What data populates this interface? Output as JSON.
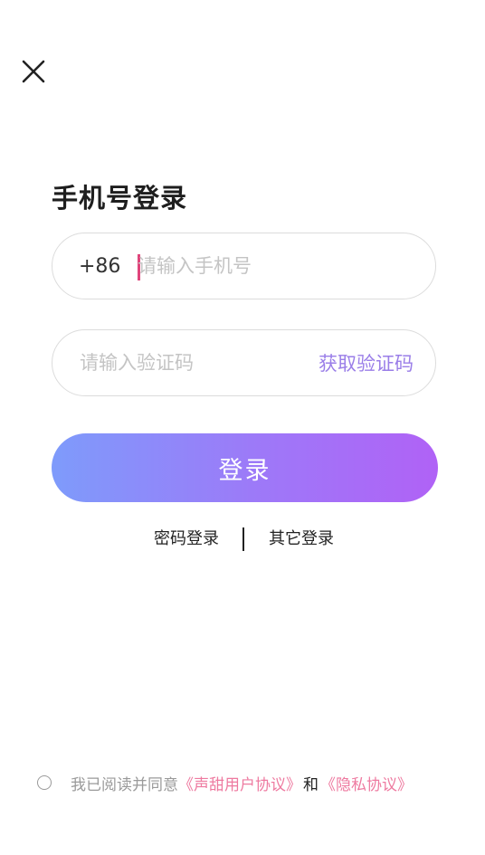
{
  "header": {
    "close_icon": "close-icon"
  },
  "page": {
    "title": "手机号登录"
  },
  "phone_field": {
    "country_code": "+86",
    "placeholder": "请输入手机号",
    "value": ""
  },
  "code_field": {
    "placeholder": "请输入验证码",
    "value": "",
    "get_code_label": "获取验证码"
  },
  "login_button": {
    "label": "登录"
  },
  "alt_logins": {
    "password_label": "密码登录",
    "other_label": "其它登录"
  },
  "agreement": {
    "prefix": "我已阅读并同意",
    "user_agreement": "《声甜用户协议》",
    "and": "和",
    "privacy_policy": "《隐私协议》"
  },
  "colors": {
    "accent": "#9a7ee8",
    "caret": "#e0457b",
    "link": "#ee7aa0",
    "gradient_start": "#7e9bfb",
    "gradient_end": "#b062f6"
  }
}
